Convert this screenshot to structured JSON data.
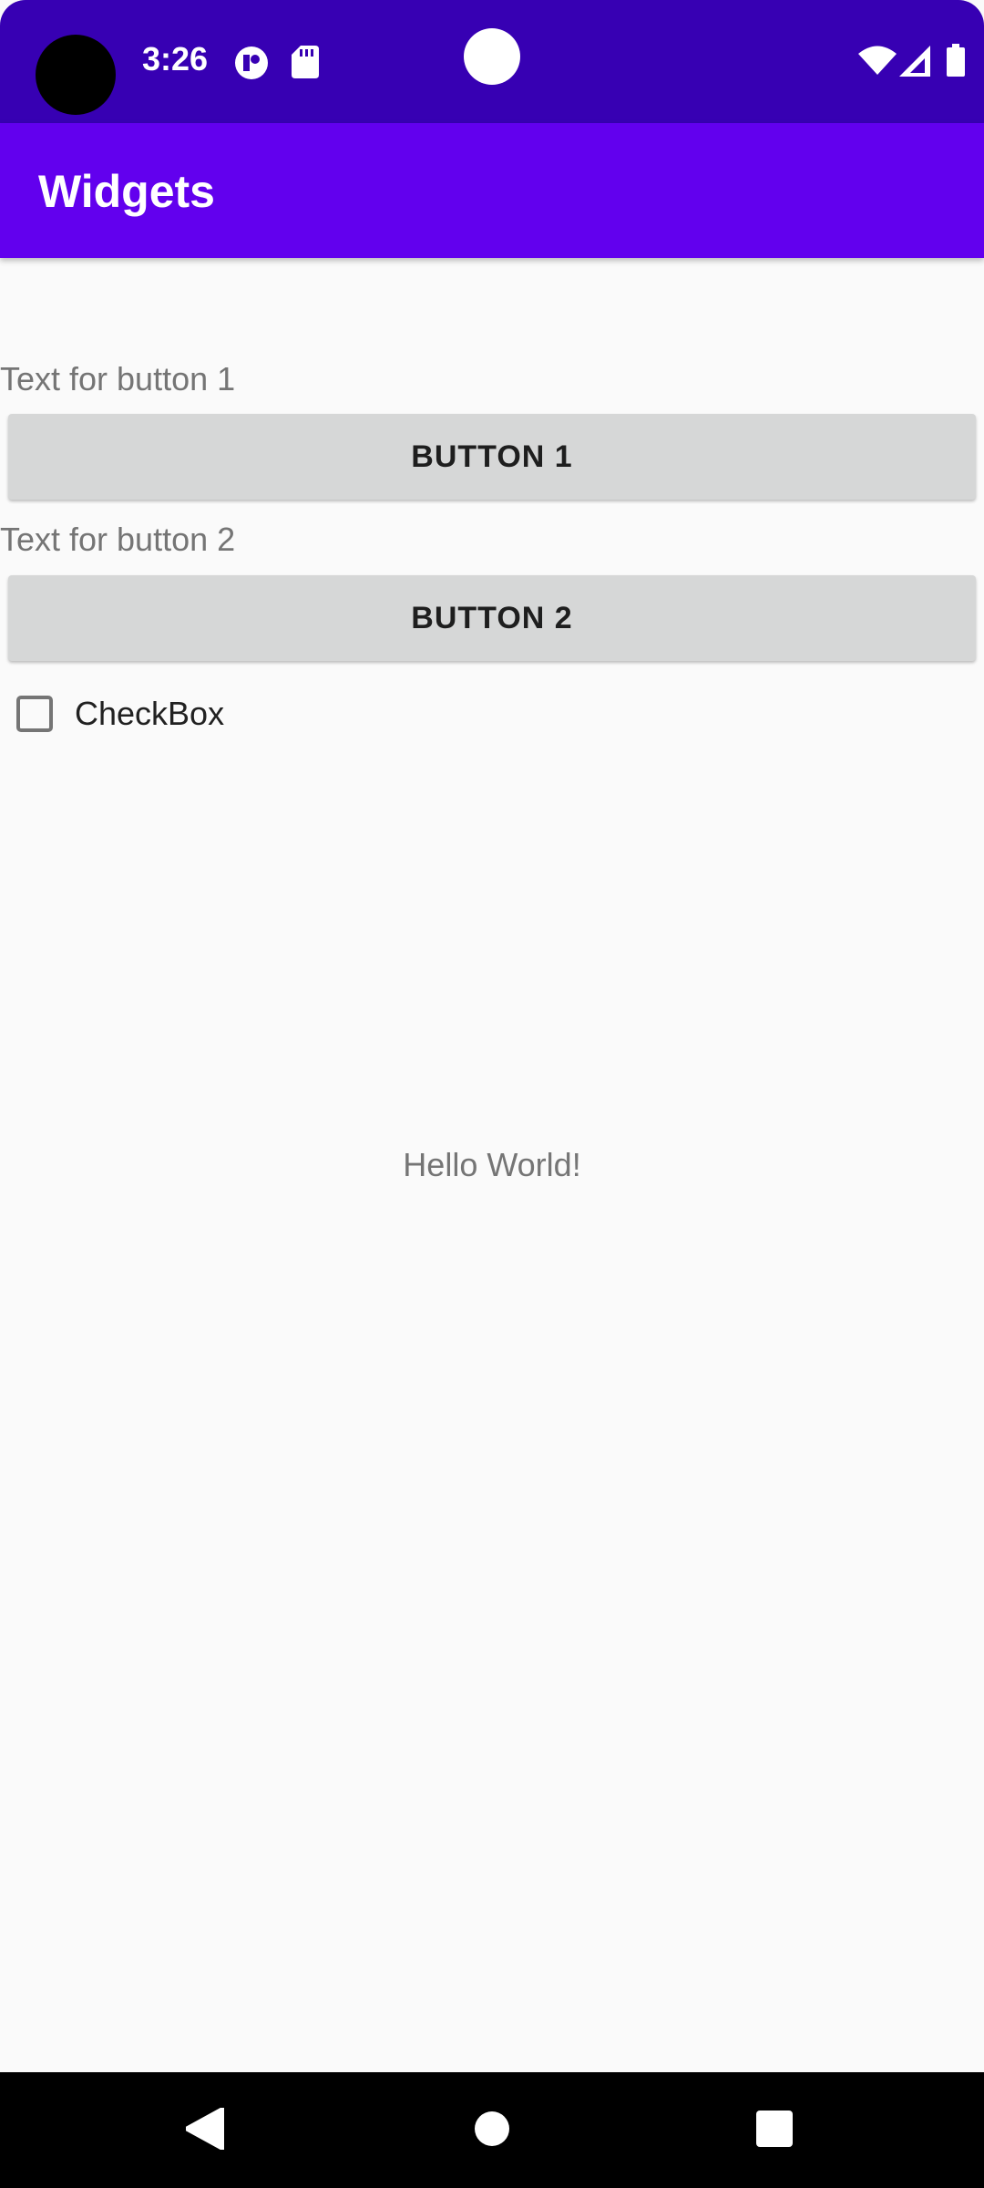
{
  "status_bar": {
    "time": "3:26",
    "icons": [
      "notification-app-icon",
      "sd-card-icon",
      "wifi-icon",
      "cell-signal-icon",
      "battery-icon"
    ]
  },
  "app_bar": {
    "title": "Widgets"
  },
  "main": {
    "button1_caption": "Text for button 1",
    "button1_label": "BUTTON 1",
    "button2_caption": "Text for button 2",
    "button2_label": "BUTTON 2",
    "checkbox_label": "CheckBox",
    "checkbox_checked": false,
    "hello_text": "Hello World!"
  },
  "nav_bar": {
    "icons": [
      "back-icon",
      "home-icon",
      "recents-icon"
    ]
  },
  "colors": {
    "status_bar": "#3700b3",
    "app_bar": "#6200ee",
    "button": "#d6d7d7",
    "background": "#fafafa"
  }
}
